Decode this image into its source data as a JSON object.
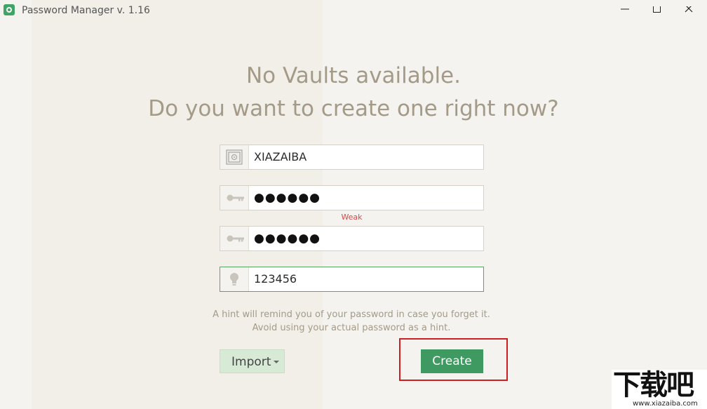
{
  "window": {
    "title": "Password Manager v. 1.16",
    "controls": [
      "minimize",
      "maximize",
      "close"
    ]
  },
  "heading": {
    "line1": "No Vaults available.",
    "line2": "Do you want to create one right now?"
  },
  "form": {
    "vault_name": {
      "icon": "safe-icon",
      "value": "XIAZAIBA"
    },
    "password": {
      "icon": "key-icon",
      "value": "●●●●●●"
    },
    "strength_label": "Weak",
    "confirm_password": {
      "icon": "key-icon",
      "value": "●●●●●●"
    },
    "hint": {
      "icon": "lightbulb-icon",
      "value": "123456"
    },
    "hint_help_line1": "A hint will remind you of your password in case you forget it.",
    "hint_help_line2": "Avoid using your actual password as a hint."
  },
  "actions": {
    "import_label": "Import",
    "create_label": "Create"
  },
  "watermark": {
    "text": "下载吧",
    "url": "www.xiazaiba.com"
  },
  "colors": {
    "background": "#f5f3ef",
    "heading": "#a39a88",
    "accent_green": "#3f9a62",
    "weak_red": "#d24a4a",
    "highlight_red": "#cc1f1f"
  }
}
